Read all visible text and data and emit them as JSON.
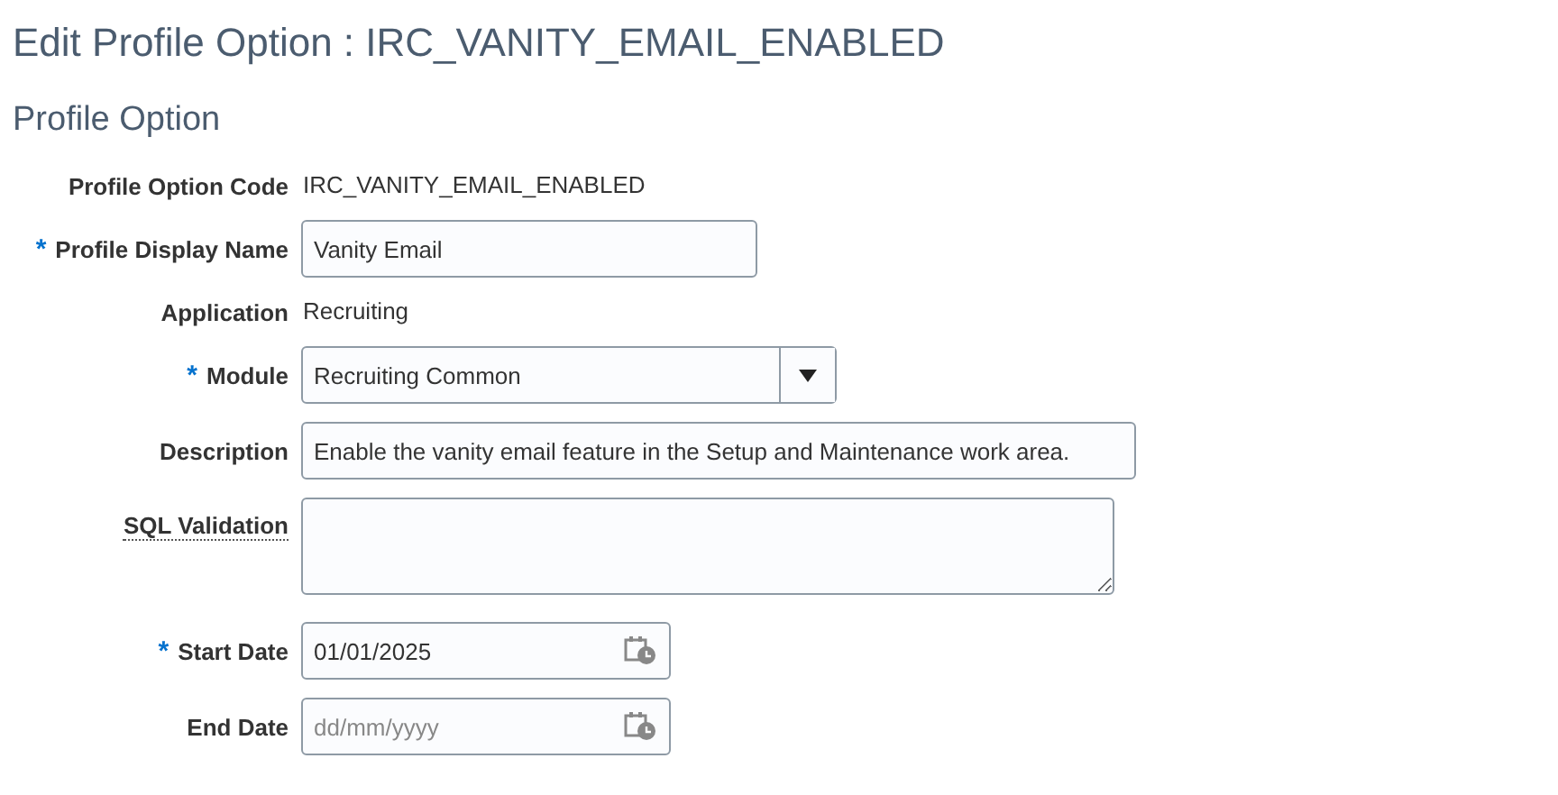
{
  "page_title": "Edit Profile Option : IRC_VANITY_EMAIL_ENABLED",
  "section_title": "Profile Option",
  "required_mark": "*",
  "fields": [
    {
      "kind": "text",
      "label": "Profile Option Code",
      "value": "IRC_VANITY_EMAIL_ENABLED",
      "required": false
    },
    {
      "kind": "input",
      "label": "Profile Display Name",
      "value": "Vanity Email",
      "required": true
    },
    {
      "kind": "text",
      "label": "Application",
      "value": "Recruiting",
      "required": false
    },
    {
      "kind": "select",
      "label": "Module",
      "value": "Recruiting Common",
      "required": true
    },
    {
      "kind": "input",
      "label": "Description",
      "value": "Enable the vanity email feature in the Setup and Maintenance work area.",
      "required": false
    },
    {
      "kind": "textarea",
      "label": "SQL Validation",
      "required": false,
      "help": true
    },
    {
      "kind": "date",
      "label": "Start Date",
      "value": "01/01/2025",
      "required": true
    },
    {
      "kind": "date",
      "label": "End Date",
      "placeholder": "dd/mm/yyyy",
      "required": false
    }
  ]
}
